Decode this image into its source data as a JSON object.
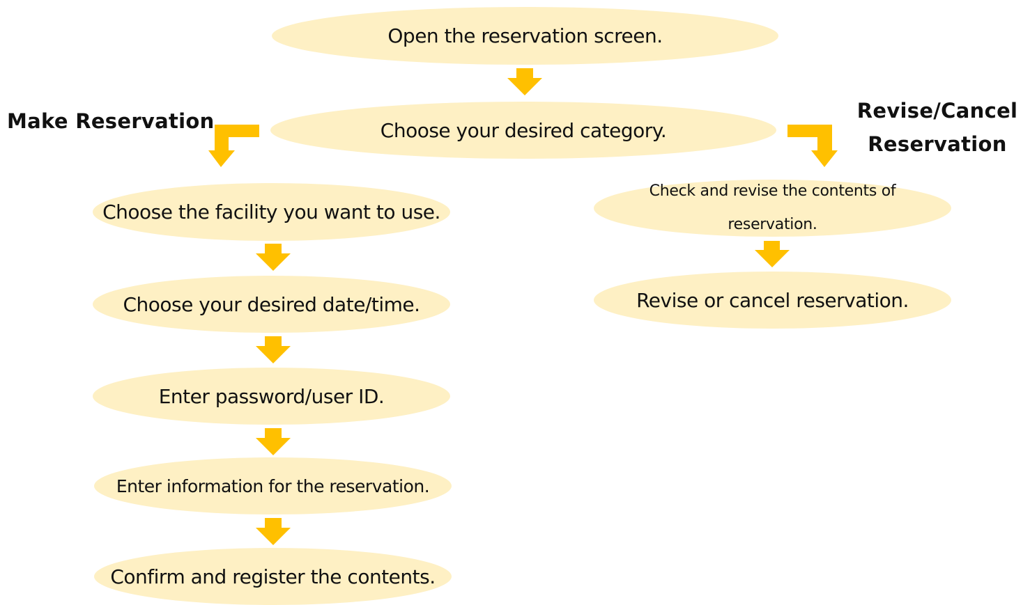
{
  "colors": {
    "node_fill": "#fef0c4",
    "arrow": "#ffc000",
    "text": "#111111"
  },
  "nodes": {
    "open_screen": "Open the reservation screen.",
    "choose_category": "Choose your desired category.",
    "choose_facility": "Choose the facility you want to use.",
    "choose_datetime": "Choose your desired date/time.",
    "enter_password": "Enter password/user ID.",
    "enter_info": "Enter information for the reservation.",
    "confirm_register": "Confirm and register the contents.",
    "check_revise_line1": "Check and revise the contents of",
    "check_revise_line2": "reservation.",
    "revise_cancel": "Revise or cancel reservation."
  },
  "labels": {
    "make_reservation": "Make Reservation",
    "revise_cancel_line1": "Revise/Cancel",
    "revise_cancel_line2": "Reservation"
  }
}
